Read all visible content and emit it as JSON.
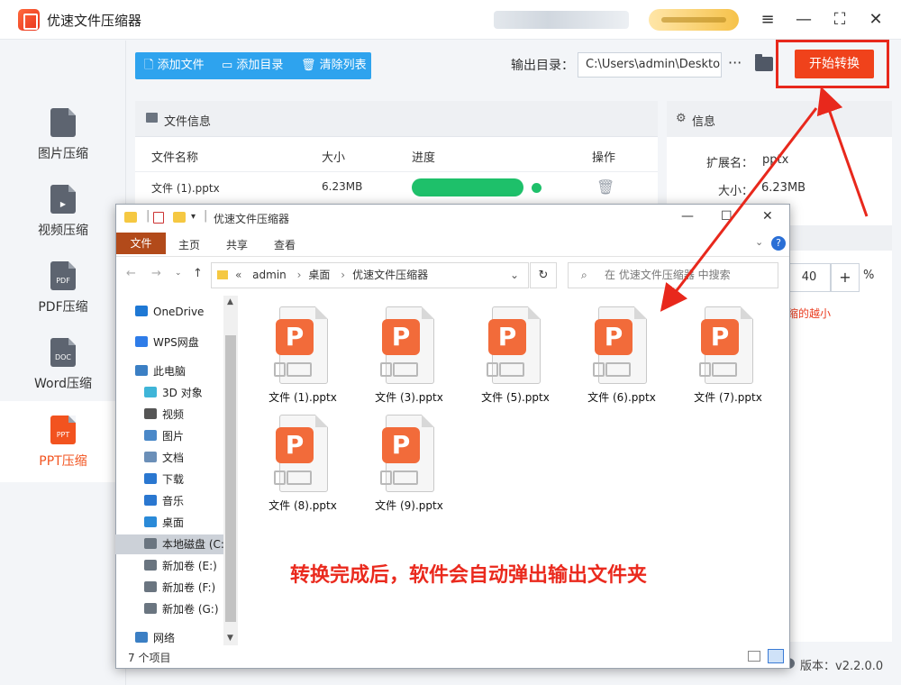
{
  "app": {
    "title": "优速文件压缩器",
    "version": "版本：v2.2.0.0"
  },
  "window_controls": {
    "menu": "≡",
    "minimize": "—",
    "maximize": "⛶",
    "close": "✕"
  },
  "sidebar": {
    "items": [
      {
        "label": "图片压缩",
        "icon_text": "",
        "icon": "image-file-icon"
      },
      {
        "label": "视频压缩",
        "icon_text": "▶",
        "icon": "video-file-icon"
      },
      {
        "label": "PDF压缩",
        "icon_text": "PDF",
        "icon": "pdf-file-icon"
      },
      {
        "label": "Word压缩",
        "icon_text": "DOC",
        "icon": "doc-file-icon"
      },
      {
        "label": "PPT压缩",
        "icon_text": "PPT",
        "icon": "ppt-file-icon"
      }
    ],
    "active": 4
  },
  "toolbar": {
    "add_file": "添加文件",
    "add_dir": "添加目录",
    "clear_list": "清除列表"
  },
  "output": {
    "label": "输出目录：",
    "path": "C:\\Users\\admin\\Desktop",
    "more": "···"
  },
  "start_button": "开始转换",
  "file_panel": {
    "title": "文件信息",
    "columns": [
      "文件名称",
      "大小",
      "进度",
      "操作"
    ],
    "rows": [
      {
        "name": "文件 (1).pptx",
        "size": "6.23MB",
        "progress": 1.0
      }
    ]
  },
  "info_panel": {
    "title": "信息",
    "ext_label": "扩展名：",
    "ext_value": "pptx",
    "size_label": "大小：",
    "size_value": "6.23MB",
    "quality_value": "40",
    "quality_plus": "+",
    "quality_unit": "%",
    "hint": "缩的越小"
  },
  "explorer": {
    "title": "优速文件压缩器",
    "ribbon": {
      "file": "文件",
      "home": "主页",
      "share": "共享",
      "view": "查看"
    },
    "address": [
      "admin",
      "桌面",
      "优速文件压缩器"
    ],
    "search_placeholder": "在 优速文件压缩器 中搜索",
    "nav": [
      {
        "label": "OneDrive",
        "icon": "cloud-icon",
        "color": "#1e78d4"
      },
      {
        "label": "WPS网盘",
        "icon": "cloud-icon",
        "color": "#2e7ce8"
      },
      {
        "label": "此电脑",
        "icon": "computer-icon",
        "color": "#3b7fc4"
      },
      {
        "label": "3D 对象",
        "icon": "cube-icon",
        "color": "#3fb5d8"
      },
      {
        "label": "视频",
        "icon": "film-icon",
        "color": "#555555"
      },
      {
        "label": "图片",
        "icon": "picture-icon",
        "color": "#4a88c8"
      },
      {
        "label": "文档",
        "icon": "document-icon",
        "color": "#6b8fb8"
      },
      {
        "label": "下载",
        "icon": "download-icon",
        "color": "#2a77d0"
      },
      {
        "label": "音乐",
        "icon": "music-icon",
        "color": "#2a77d0"
      },
      {
        "label": "桌面",
        "icon": "desktop-icon",
        "color": "#2a8ad8"
      },
      {
        "label": "本地磁盘 (C:)",
        "icon": "drive-icon",
        "color": "#6a7580"
      },
      {
        "label": "新加卷 (E:)",
        "icon": "drive-icon",
        "color": "#6a7580"
      },
      {
        "label": "新加卷 (F:)",
        "icon": "drive-icon",
        "color": "#6a7580"
      },
      {
        "label": "新加卷 (G:)",
        "icon": "drive-icon",
        "color": "#6a7580"
      },
      {
        "label": "网络",
        "icon": "network-icon",
        "color": "#3b7fc4"
      }
    ],
    "files": [
      "文件 (1).pptx",
      "文件 (3).pptx",
      "文件 (5).pptx",
      "文件 (6).pptx",
      "文件 (7).pptx",
      "文件 (8).pptx",
      "文件 (9).pptx"
    ],
    "status": "7 个项目"
  },
  "annotation": "转换完成后，软件会自动弹出输出文件夹",
  "colors": {
    "accent": "#f0421b",
    "toolbar": "#2ea3ee",
    "progress": "#1ec06a",
    "annotation": "#ea2a1e"
  }
}
